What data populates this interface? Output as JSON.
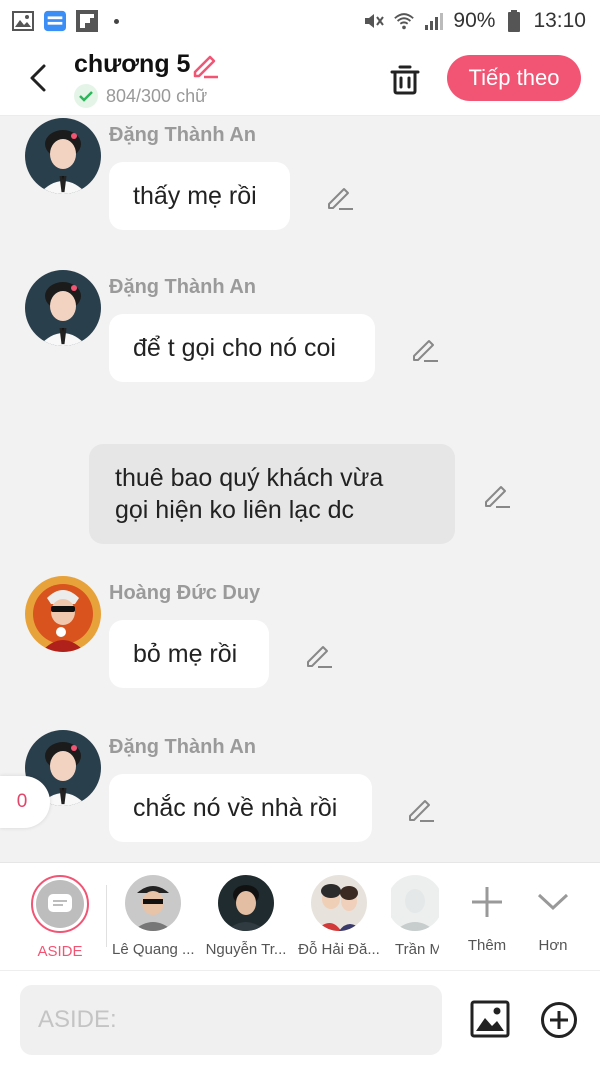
{
  "status_bar": {
    "battery": "90%",
    "time": "13:10",
    "icons": [
      "gallery-icon",
      "noveltoon-app-icon",
      "flipboard-icon",
      "mute-icon",
      "wifi-icon",
      "signal-icon",
      "battery-icon"
    ]
  },
  "header": {
    "title": "chương 5",
    "word_count": "804/300 chữ",
    "next_label": "Tiếp theo",
    "accent": "#f25574"
  },
  "messages": [
    {
      "type": "character",
      "sender": "Đặng Thành An",
      "text": "thấy mẹ rồi"
    },
    {
      "type": "character",
      "sender": "Đặng Thành An",
      "text": "để t gọi cho nó coi"
    },
    {
      "type": "aside",
      "lines": [
        "thuê bao quý khách vừa",
        "gọi hiện ko liên lạc dc"
      ]
    },
    {
      "type": "character",
      "sender": "Hoàng Đức Duy",
      "text": "bỏ mẹ rồi"
    },
    {
      "type": "character",
      "sender": "Đặng Thành An",
      "text": "chắc nó về nhà rồi"
    }
  ],
  "side_badge": "0",
  "characters": [
    {
      "label": "ASIDE"
    },
    {
      "label": "Lê Quang ..."
    },
    {
      "label": "Nguyễn Tr..."
    },
    {
      "label": "Đỗ Hải Đă..."
    },
    {
      "label": "Trần M"
    },
    {
      "label": "Thêm"
    },
    {
      "label": "Hơn"
    }
  ],
  "input": {
    "placeholder": "ASIDE:"
  }
}
